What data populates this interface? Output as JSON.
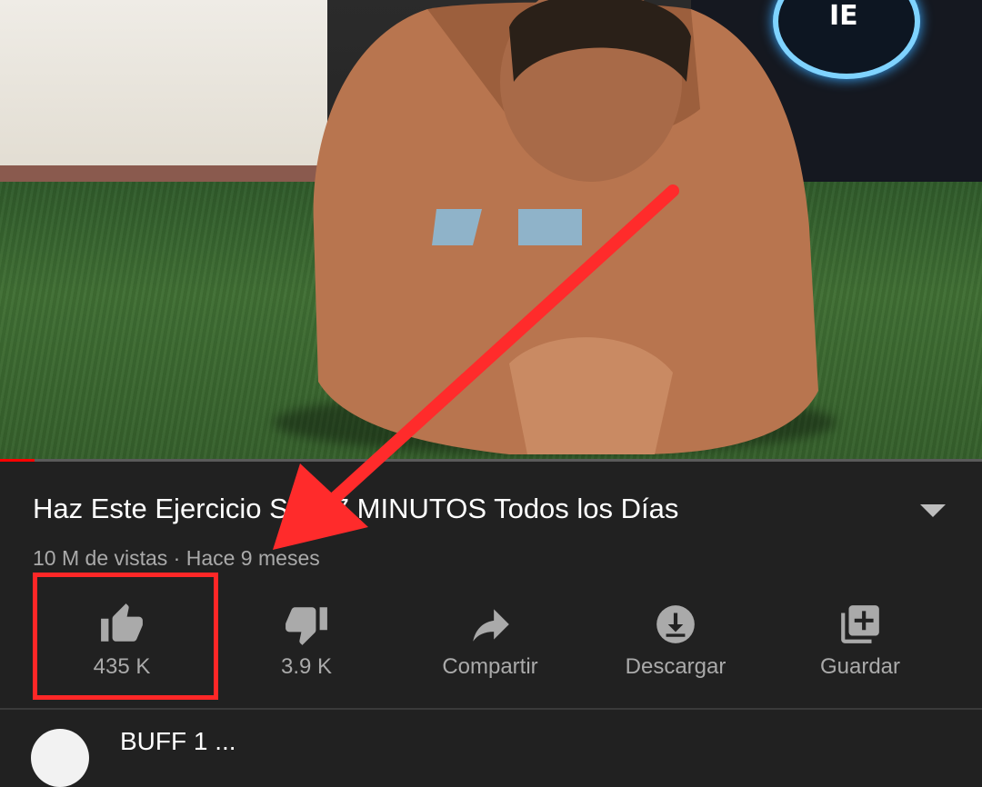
{
  "video": {
    "timer_label": "IE",
    "progress": 0.035
  },
  "title": "Haz Este Ejercicio Solo 7 MINUTOS Todos los Días",
  "meta": "10 M de vistas · Hace 9 meses",
  "actions": {
    "like": {
      "label": "435 K",
      "icon": "thumb-up-icon"
    },
    "dislike": {
      "label": "3.9 K",
      "icon": "thumb-down-icon"
    },
    "share": {
      "label": "Compartir",
      "icon": "share-icon"
    },
    "download": {
      "label": "Descargar",
      "icon": "download-icon"
    },
    "save": {
      "label": "Guardar",
      "icon": "playlist-add-icon"
    }
  },
  "channel": {
    "name": "BUFF 1 ..."
  },
  "colors": {
    "accent": "#ff2727",
    "progress": "#ff0000",
    "background": "#212121"
  }
}
